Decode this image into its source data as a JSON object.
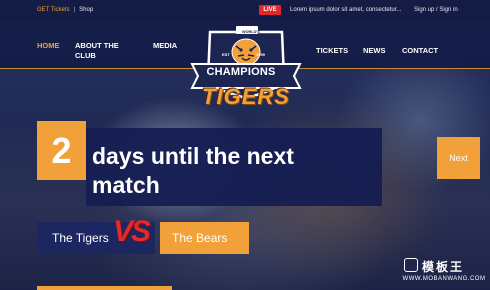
{
  "topbar": {
    "get_tickets": "GET Tickets",
    "separator": "|",
    "shop": "Shop",
    "live_label": "LIVE",
    "ticker_text": "Lorem ipsum dolor sit amet, consectetur...",
    "auth": "Sign up / Sign in"
  },
  "nav": {
    "home": "HOME",
    "about_line1": "ABOUT THE",
    "about_line2": "CLUB",
    "media": "MEDIA",
    "tickets": "TICKETS",
    "news": "NEWS",
    "contact": "CONTACT"
  },
  "logo": {
    "worlds": "WORLD'S",
    "est": "EST",
    "year": "1999",
    "champions": "CHAMPIONS",
    "tigers": "TIGERS"
  },
  "countdown": {
    "days": "2",
    "line1": "days until the next",
    "line2": "match",
    "next_label": "Next"
  },
  "match": {
    "home_team": "The Tigers",
    "vs": "VS",
    "away_team": "The Bears"
  },
  "watermark": {
    "brand": "模板王",
    "url": "WWW.MOBANWANG.COM"
  },
  "colors": {
    "accent": "#f2a03a",
    "navy": "#1c2452",
    "live_red": "#e2262b",
    "vs_red": "#e22a2a"
  }
}
